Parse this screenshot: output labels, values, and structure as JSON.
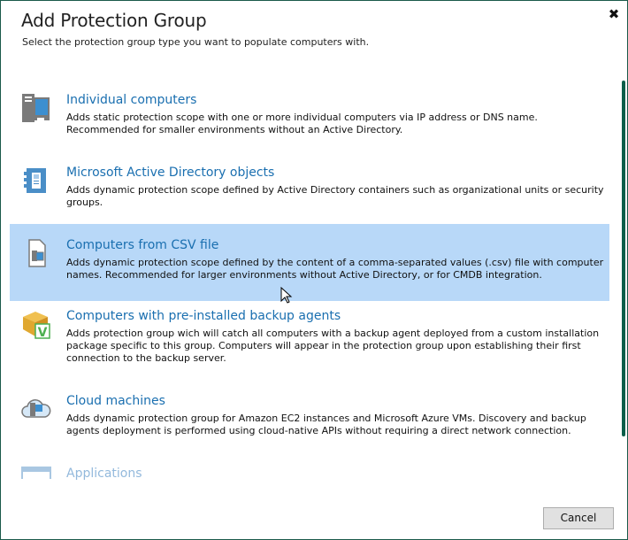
{
  "dialog": {
    "title": "Add Protection Group",
    "subtitle": "Select the protection group type you want to populate computers with.",
    "close_icon": "close-icon",
    "cancel_label": "Cancel"
  },
  "items": [
    {
      "name": "Individual computers",
      "desc": "Adds static protection scope with one or more individual computers via IP address or DNS name. Recommended for smaller environments without an Active Directory.",
      "icon": "computer-icon"
    },
    {
      "name": "Microsoft Active Directory objects",
      "desc": "Adds dynamic protection scope defined by Active Directory containers such as organizational units or security groups.",
      "icon": "directory-icon"
    },
    {
      "name": "Computers from CSV file",
      "desc": "Adds dynamic protection scope defined by the content of a comma-separated values (.csv) file with computer names. Recommended for larger environments without Active Directory, or for CMDB integration.",
      "icon": "csv-file-icon",
      "selected": true
    },
    {
      "name": "Computers with pre-installed backup agents",
      "desc": "Adds protection group wich will catch all computers with a backup agent deployed from a custom installation package specific to this group. Computers will appear in the protection group upon establishing their first connection to the backup server.",
      "icon": "package-icon"
    },
    {
      "name": "Cloud machines",
      "desc": "Adds dynamic protection group for Amazon EC2 instances and Microsoft Azure VMs. Discovery and backup agents deployment is performed using cloud-native APIs without requiring a direct network connection.",
      "icon": "cloud-icon"
    },
    {
      "name": "Applications",
      "desc": "",
      "icon": "application-icon"
    }
  ],
  "colors": {
    "accent": "#1a6fb0",
    "selected": "#b8d8f8",
    "border": "#1a5a4a"
  }
}
